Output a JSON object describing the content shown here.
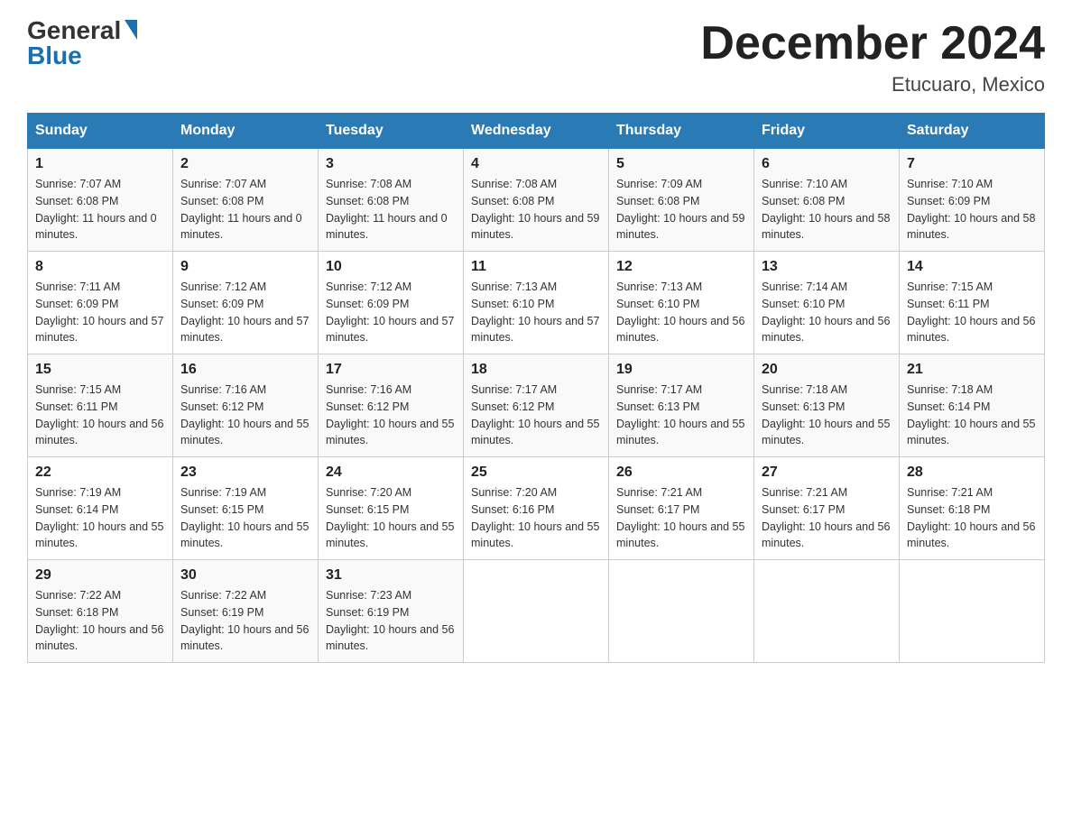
{
  "header": {
    "logo": {
      "general": "General",
      "triangle": "▶",
      "blue": "Blue"
    },
    "title": "December 2024",
    "location": "Etucuaro, Mexico"
  },
  "days_of_week": [
    "Sunday",
    "Monday",
    "Tuesday",
    "Wednesday",
    "Thursday",
    "Friday",
    "Saturday"
  ],
  "weeks": [
    [
      {
        "day": "1",
        "sunrise": "7:07 AM",
        "sunset": "6:08 PM",
        "daylight": "11 hours and 0 minutes."
      },
      {
        "day": "2",
        "sunrise": "7:07 AM",
        "sunset": "6:08 PM",
        "daylight": "11 hours and 0 minutes."
      },
      {
        "day": "3",
        "sunrise": "7:08 AM",
        "sunset": "6:08 PM",
        "daylight": "11 hours and 0 minutes."
      },
      {
        "day": "4",
        "sunrise": "7:08 AM",
        "sunset": "6:08 PM",
        "daylight": "10 hours and 59 minutes."
      },
      {
        "day": "5",
        "sunrise": "7:09 AM",
        "sunset": "6:08 PM",
        "daylight": "10 hours and 59 minutes."
      },
      {
        "day": "6",
        "sunrise": "7:10 AM",
        "sunset": "6:08 PM",
        "daylight": "10 hours and 58 minutes."
      },
      {
        "day": "7",
        "sunrise": "7:10 AM",
        "sunset": "6:09 PM",
        "daylight": "10 hours and 58 minutes."
      }
    ],
    [
      {
        "day": "8",
        "sunrise": "7:11 AM",
        "sunset": "6:09 PM",
        "daylight": "10 hours and 57 minutes."
      },
      {
        "day": "9",
        "sunrise": "7:12 AM",
        "sunset": "6:09 PM",
        "daylight": "10 hours and 57 minutes."
      },
      {
        "day": "10",
        "sunrise": "7:12 AM",
        "sunset": "6:09 PM",
        "daylight": "10 hours and 57 minutes."
      },
      {
        "day": "11",
        "sunrise": "7:13 AM",
        "sunset": "6:10 PM",
        "daylight": "10 hours and 57 minutes."
      },
      {
        "day": "12",
        "sunrise": "7:13 AM",
        "sunset": "6:10 PM",
        "daylight": "10 hours and 56 minutes."
      },
      {
        "day": "13",
        "sunrise": "7:14 AM",
        "sunset": "6:10 PM",
        "daylight": "10 hours and 56 minutes."
      },
      {
        "day": "14",
        "sunrise": "7:15 AM",
        "sunset": "6:11 PM",
        "daylight": "10 hours and 56 minutes."
      }
    ],
    [
      {
        "day": "15",
        "sunrise": "7:15 AM",
        "sunset": "6:11 PM",
        "daylight": "10 hours and 56 minutes."
      },
      {
        "day": "16",
        "sunrise": "7:16 AM",
        "sunset": "6:12 PM",
        "daylight": "10 hours and 55 minutes."
      },
      {
        "day": "17",
        "sunrise": "7:16 AM",
        "sunset": "6:12 PM",
        "daylight": "10 hours and 55 minutes."
      },
      {
        "day": "18",
        "sunrise": "7:17 AM",
        "sunset": "6:12 PM",
        "daylight": "10 hours and 55 minutes."
      },
      {
        "day": "19",
        "sunrise": "7:17 AM",
        "sunset": "6:13 PM",
        "daylight": "10 hours and 55 minutes."
      },
      {
        "day": "20",
        "sunrise": "7:18 AM",
        "sunset": "6:13 PM",
        "daylight": "10 hours and 55 minutes."
      },
      {
        "day": "21",
        "sunrise": "7:18 AM",
        "sunset": "6:14 PM",
        "daylight": "10 hours and 55 minutes."
      }
    ],
    [
      {
        "day": "22",
        "sunrise": "7:19 AM",
        "sunset": "6:14 PM",
        "daylight": "10 hours and 55 minutes."
      },
      {
        "day": "23",
        "sunrise": "7:19 AM",
        "sunset": "6:15 PM",
        "daylight": "10 hours and 55 minutes."
      },
      {
        "day": "24",
        "sunrise": "7:20 AM",
        "sunset": "6:15 PM",
        "daylight": "10 hours and 55 minutes."
      },
      {
        "day": "25",
        "sunrise": "7:20 AM",
        "sunset": "6:16 PM",
        "daylight": "10 hours and 55 minutes."
      },
      {
        "day": "26",
        "sunrise": "7:21 AM",
        "sunset": "6:17 PM",
        "daylight": "10 hours and 55 minutes."
      },
      {
        "day": "27",
        "sunrise": "7:21 AM",
        "sunset": "6:17 PM",
        "daylight": "10 hours and 56 minutes."
      },
      {
        "day": "28",
        "sunrise": "7:21 AM",
        "sunset": "6:18 PM",
        "daylight": "10 hours and 56 minutes."
      }
    ],
    [
      {
        "day": "29",
        "sunrise": "7:22 AM",
        "sunset": "6:18 PM",
        "daylight": "10 hours and 56 minutes."
      },
      {
        "day": "30",
        "sunrise": "7:22 AM",
        "sunset": "6:19 PM",
        "daylight": "10 hours and 56 minutes."
      },
      {
        "day": "31",
        "sunrise": "7:23 AM",
        "sunset": "6:19 PM",
        "daylight": "10 hours and 56 minutes."
      },
      null,
      null,
      null,
      null
    ]
  ]
}
